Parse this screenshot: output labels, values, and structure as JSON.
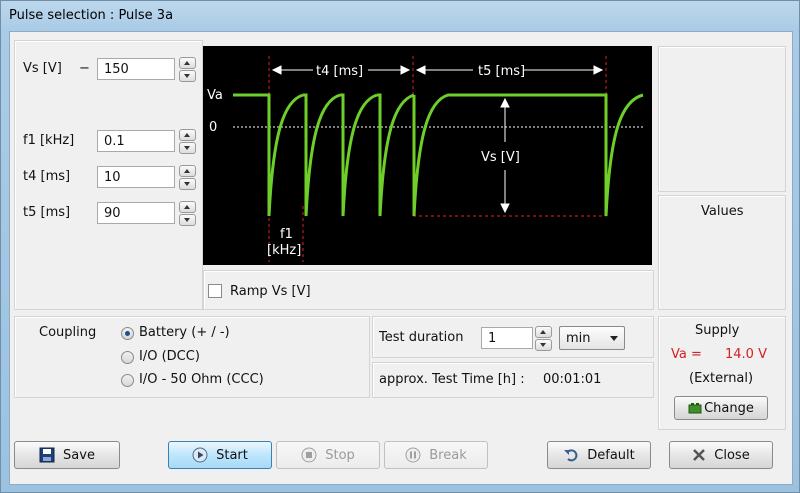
{
  "window": {
    "title": "Pulse selection : Pulse 3a"
  },
  "params": {
    "vs": {
      "label": "Vs [V]",
      "sign": "−",
      "value": "150"
    },
    "f1": {
      "label": "f1 [kHz]",
      "value": "0.1"
    },
    "t4": {
      "label": "t4 [ms]",
      "value": "10"
    },
    "t5": {
      "label": "t5 [ms]",
      "value": "90"
    }
  },
  "diagram": {
    "va": "Va",
    "zero": "0",
    "t4": "t4 [ms]",
    "t5": "t5 [ms]",
    "vs": "Vs [V]",
    "f1": "f1",
    "f1_unit": "[kHz]",
    "wave_color": "#6fcf2a",
    "marker_color": "#e02020"
  },
  "ramp": {
    "label": "Ramp Vs [V]",
    "checked": false
  },
  "values": {
    "title": "Values"
  },
  "coupling": {
    "label": "Coupling",
    "options": [
      "Battery (+ / -)",
      "I/O (DCC)",
      "I/O - 50 Ohm (CCC)"
    ],
    "selected": 0
  },
  "test": {
    "duration_label": "Test duration",
    "duration_value": "1",
    "unit": "min",
    "approx_label": "approx. Test Time [h] :",
    "approx_value": "00:01:01"
  },
  "supply": {
    "title": "Supply",
    "va_label": "Va =",
    "va_value": "14.0 V",
    "source": "(External)",
    "change_label": "Change"
  },
  "buttons": {
    "save": "Save",
    "start": "Start",
    "stop": "Stop",
    "break": "Break",
    "default": "Default",
    "close": "Close"
  }
}
